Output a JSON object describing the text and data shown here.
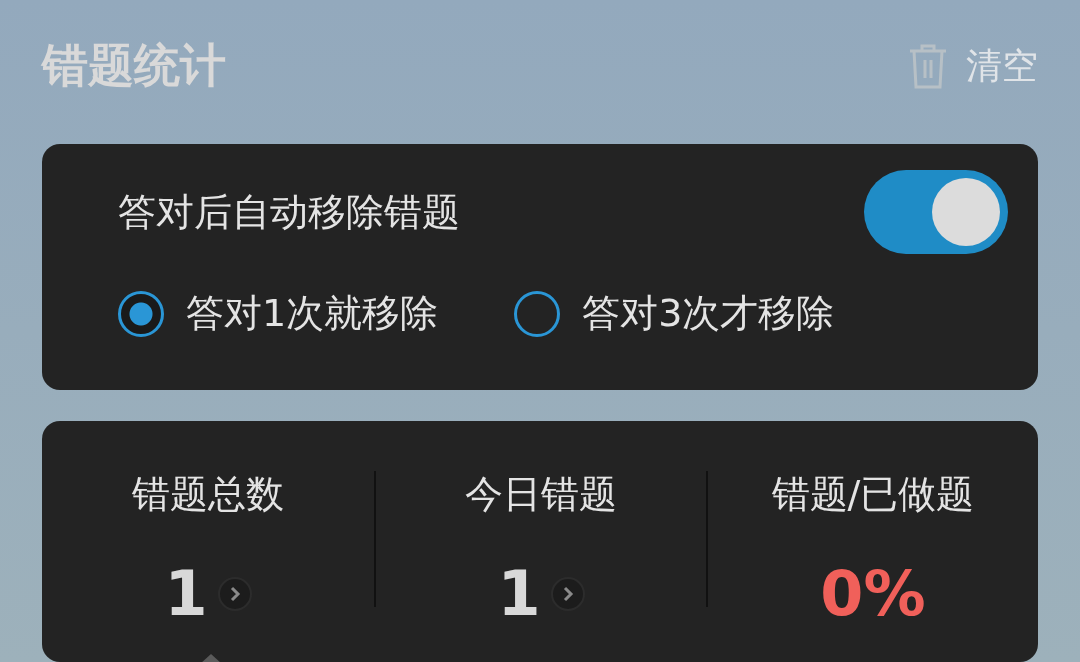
{
  "header": {
    "title": "错题统计",
    "clear_button": "清空"
  },
  "auto_remove": {
    "label": "答对后自动移除错题",
    "on": true
  },
  "options": [
    {
      "label": "答对1次就移除",
      "selected": true
    },
    {
      "label": "答对3次才移除",
      "selected": false
    }
  ],
  "stats": [
    {
      "kind": "count",
      "label": "错题总数",
      "value": "1"
    },
    {
      "kind": "count",
      "label": "今日错题",
      "value": "1"
    },
    {
      "kind": "percent",
      "label": "错题/已做题",
      "value": "0%"
    }
  ]
}
